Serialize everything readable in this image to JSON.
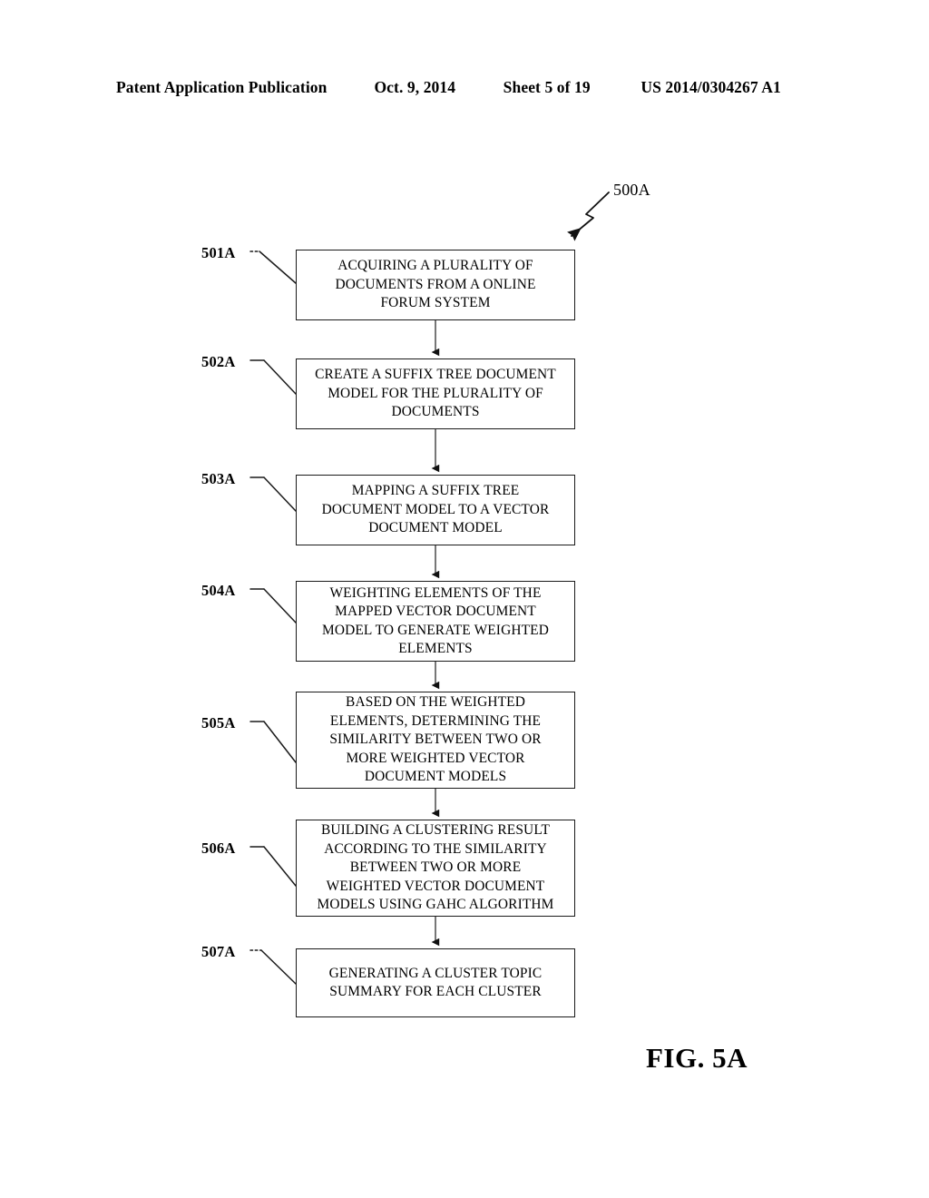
{
  "header": {
    "publication": "Patent Application Publication",
    "date": "Oct. 9, 2014",
    "sheet": "Sheet 5 of 19",
    "document_number": "US 2014/0304267 A1"
  },
  "figure": {
    "reference": "500A",
    "caption": "FIG. 5A",
    "ink_color": "#000000",
    "background_color": "#ffffff",
    "steps": [
      {
        "ref": "501A",
        "text": "ACQUIRING A PLURALITY OF\nDOCUMENTS FROM A ONLINE\nFORUM SYSTEM"
      },
      {
        "ref": "502A",
        "text": "CREATE A SUFFIX TREE DOCUMENT\nMODEL FOR THE PLURALITY OF\nDOCUMENTS"
      },
      {
        "ref": "503A",
        "text": "MAPPING A SUFFIX TREE\nDOCUMENT MODEL TO A VECTOR\nDOCUMENT MODEL"
      },
      {
        "ref": "504A",
        "text": "WEIGHTING ELEMENTS OF THE\nMAPPED VECTOR DOCUMENT\nMODEL TO GENERATE WEIGHTED\nELEMENTS"
      },
      {
        "ref": "505A",
        "text": "BASED ON THE WEIGHTED\nELEMENTS, DETERMINING THE\nSIMILARITY BETWEEN TWO OR\nMORE WEIGHTED VECTOR\nDOCUMENT MODELS"
      },
      {
        "ref": "506A",
        "text": "BUILDING A CLUSTERING RESULT\nACCORDING TO THE SIMILARITY\nBETWEEN TWO OR MORE\nWEIGHTED VECTOR DOCUMENT\nMODELS USING GAHC ALGORITHM"
      },
      {
        "ref": "507A",
        "text": "GENERATING A CLUSTER TOPIC\nSUMMARY FOR EACH CLUSTER"
      }
    ]
  }
}
